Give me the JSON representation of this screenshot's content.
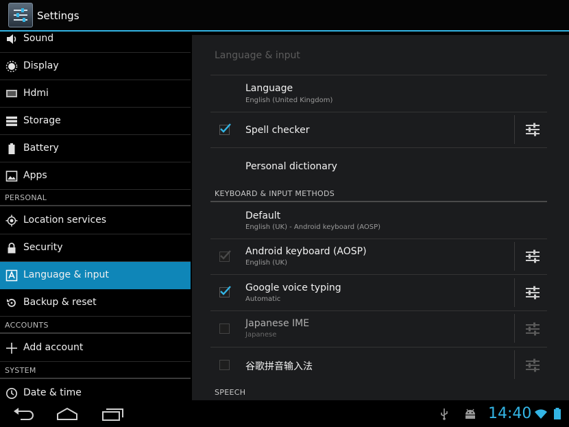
{
  "app": {
    "title": "Settings"
  },
  "sidebar": {
    "items": [
      {
        "label": "Sound",
        "icon": "speaker-icon"
      },
      {
        "label": "Display",
        "icon": "brightness-icon"
      },
      {
        "label": "Hdmi",
        "icon": "monitor-icon"
      },
      {
        "label": "Storage",
        "icon": "storage-icon"
      },
      {
        "label": "Battery",
        "icon": "battery-icon"
      },
      {
        "label": "Apps",
        "icon": "apps-icon"
      },
      {
        "label": "Location services",
        "icon": "location-icon"
      },
      {
        "label": "Security",
        "icon": "lock-icon"
      },
      {
        "label": "Language & input",
        "icon": "language-icon",
        "selected": true
      },
      {
        "label": "Backup & reset",
        "icon": "backup-icon"
      },
      {
        "label": "Add account",
        "icon": "plus-icon"
      },
      {
        "label": "Date & time",
        "icon": "clock-icon"
      }
    ],
    "headers": {
      "personal": "PERSONAL",
      "accounts": "ACCOUNTS",
      "system": "SYSTEM"
    }
  },
  "pane": {
    "title": "Language & input",
    "language": {
      "title": "Language",
      "summary": "English (United Kingdom)"
    },
    "spell_checker": {
      "title": "Spell checker",
      "checked": true
    },
    "personal_dictionary": {
      "title": "Personal dictionary"
    },
    "keyboard_section": "KEYBOARD & INPUT METHODS",
    "default": {
      "title": "Default",
      "summary": "English (UK) - Android keyboard (AOSP)"
    },
    "methods": [
      {
        "title": "Android keyboard (AOSP)",
        "summary": "English (UK)",
        "checked": true,
        "enabled": false
      },
      {
        "title": "Google voice typing",
        "summary": "Automatic",
        "checked": true,
        "enabled": true
      },
      {
        "title": "Japanese IME",
        "summary": "Japanese",
        "checked": false,
        "enabled": true
      },
      {
        "title": "谷歌拼音输入法",
        "summary": "",
        "checked": false,
        "enabled": true
      }
    ],
    "speech_section": "SPEECH"
  },
  "status": {
    "time": "14:40"
  },
  "colors": {
    "accent": "#33b5e5",
    "selected": "#0f86b8",
    "pane_bg": "#1b1c1e"
  }
}
